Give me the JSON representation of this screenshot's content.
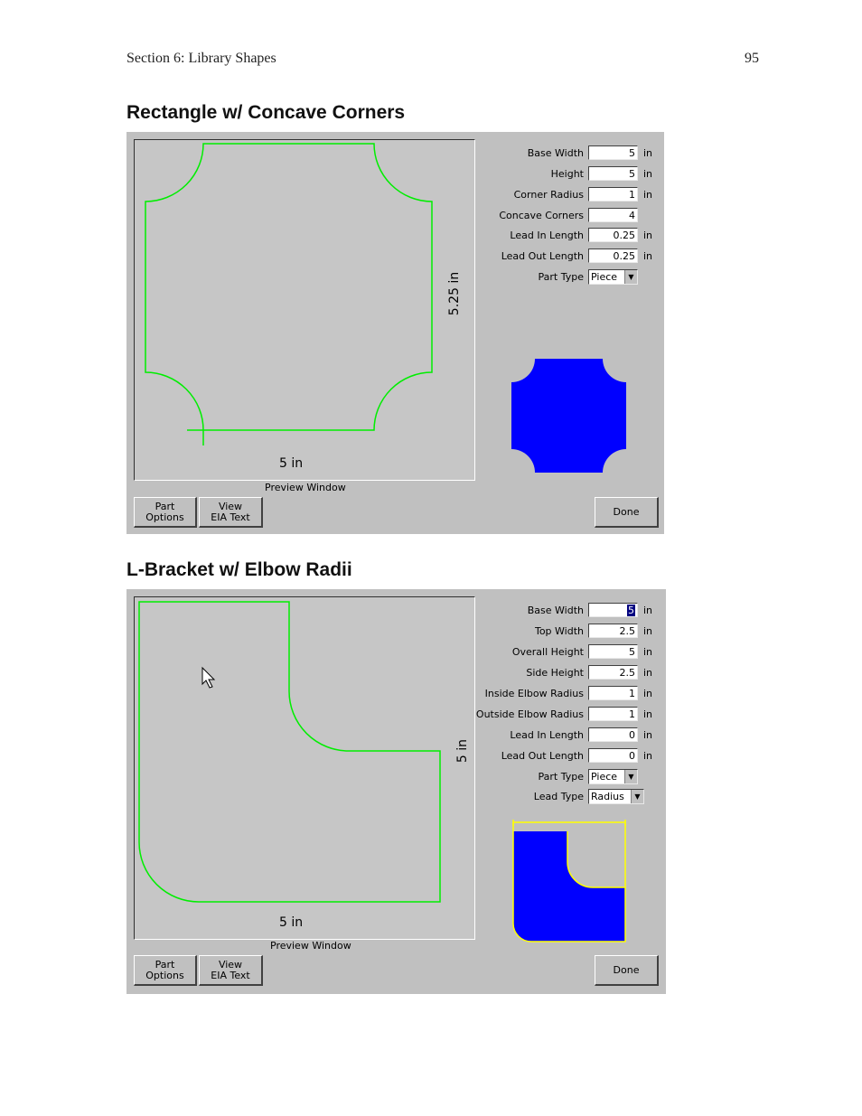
{
  "header": {
    "section": "Section 6: Library Shapes",
    "page": "95"
  },
  "sections": [
    {
      "title": "Rectangle w/ Concave Corners",
      "preview_label": "Preview Window",
      "dim_horizontal": "5 in",
      "dim_vertical": "5.25 in",
      "fields": [
        {
          "label": "Base Width",
          "value": "5",
          "unit": "in"
        },
        {
          "label": "Height",
          "value": "5",
          "unit": "in"
        },
        {
          "label": "Corner Radius",
          "value": "1",
          "unit": "in"
        },
        {
          "label": "Concave Corners",
          "value": "4",
          "unit": ""
        },
        {
          "label": "Lead In Length",
          "value": "0.25",
          "unit": "in"
        },
        {
          "label": "Lead Out Length",
          "value": "0.25",
          "unit": "in"
        }
      ],
      "part_type": {
        "label": "Part Type",
        "value": "Piece"
      },
      "buttons": {
        "part_options": [
          "Part",
          "Options"
        ],
        "view_eia": [
          "View",
          "EIA Text"
        ],
        "done": "Done"
      }
    },
    {
      "title": "L-Bracket w/ Elbow Radii",
      "preview_label": "Preview Window",
      "dim_horizontal": "5 in",
      "dim_vertical": "5 in",
      "fields": [
        {
          "label": "Base Width",
          "value": "5",
          "unit": "in"
        },
        {
          "label": "Top Width",
          "value": "2.5",
          "unit": "in"
        },
        {
          "label": "Overall Height",
          "value": "5",
          "unit": "in"
        },
        {
          "label": "Side Height",
          "value": "2.5",
          "unit": "in"
        },
        {
          "label": "Inside Elbow Radius",
          "value": "1",
          "unit": "in"
        },
        {
          "label": "Outside Elbow Radius",
          "value": "1",
          "unit": "in"
        },
        {
          "label": "Lead In Length",
          "value": "0",
          "unit": "in"
        },
        {
          "label": "Lead Out Length",
          "value": "0",
          "unit": "in"
        }
      ],
      "part_type": {
        "label": "Part Type",
        "value": "Piece"
      },
      "lead_type": {
        "label": "Lead Type",
        "value": "Radius"
      },
      "buttons": {
        "part_options": [
          "Part",
          "Options"
        ],
        "view_eia": [
          "View",
          "EIA Text"
        ],
        "done": "Done"
      }
    }
  ],
  "colors": {
    "dialog_bg": "#c0c0c0",
    "outline": "#00ee00",
    "fill": "#0000ff",
    "highlight": "#ffff00"
  }
}
